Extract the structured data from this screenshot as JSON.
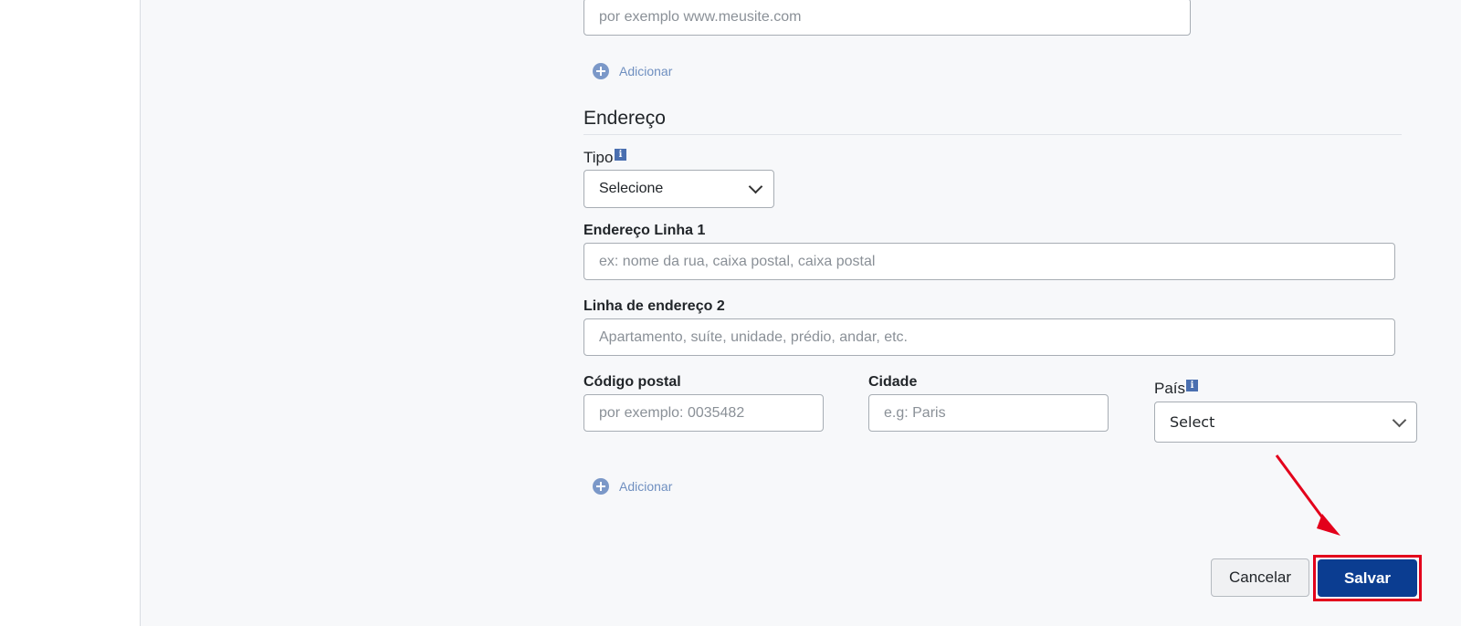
{
  "website": {
    "placeholder": "por exemplo www.meusite.com"
  },
  "add_website": {
    "label": "Adicionar"
  },
  "address": {
    "section_title": "Endereço",
    "type_label": "Tipo",
    "type_value": "Selecione",
    "line1_label": "Endereço Linha 1",
    "line1_placeholder": "ex: nome da rua, caixa postal, caixa postal",
    "line2_label": "Linha de endereço 2",
    "line2_placeholder": "Apartamento, suíte, unidade, prédio, andar, etc.",
    "postal_label": "Código postal",
    "postal_placeholder": "por exemplo: 0035482",
    "city_label": "Cidade",
    "city_placeholder": "e.g: Paris",
    "country_label": "País",
    "country_value": "Select"
  },
  "add_address": {
    "label": "Adicionar"
  },
  "actions": {
    "cancel_label": "Cancelar",
    "save_label": "Salvar"
  },
  "colors": {
    "primary": "#0b3d91",
    "annotation": "#e3001b",
    "link": "#6f8fc0"
  }
}
